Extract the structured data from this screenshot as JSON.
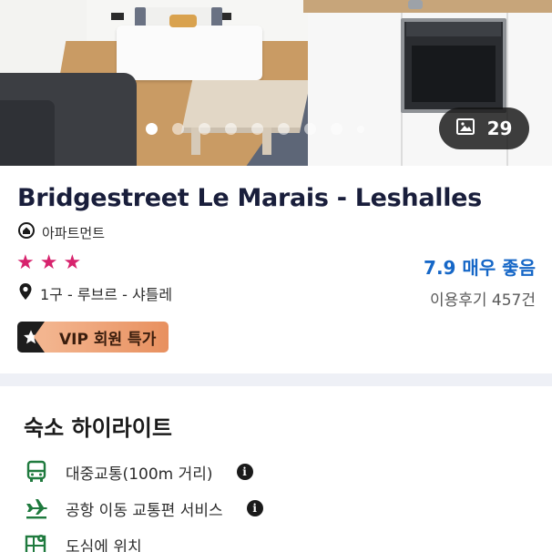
{
  "hero": {
    "photo_count": "29",
    "icons": {
      "photos": "image-icon"
    },
    "carousel": {
      "total_dots": 9,
      "active_index": 0
    }
  },
  "property": {
    "name": "Bridgestreet Le Marais - Leshalles",
    "type": "아파트먼트",
    "star_rating": 3,
    "rating_text": "7.9 매우 좋음",
    "location": "1구 - 루브르 - 샤틀레",
    "reviews": "이용후기 457건",
    "vip_label": "VIP 회원 특가",
    "icons": {
      "type": "home-icon",
      "location": "map-pin-icon",
      "vip": "star-icon"
    },
    "colors": {
      "star": "#d7236d",
      "rating": "#1667c7",
      "title": "#191e3b"
    }
  },
  "highlights": {
    "title": "숙소 하이라이트",
    "items": [
      {
        "label": "대중교통(100m 거리)",
        "icon": "bus-icon",
        "has_info": true
      },
      {
        "label": "공항 이동 교통편 서비스",
        "icon": "airplane-icon",
        "has_info": true
      },
      {
        "label": "도심에 위치",
        "icon": "city-map-icon",
        "has_info": false
      }
    ],
    "icon_color": "#1f7a3e"
  }
}
